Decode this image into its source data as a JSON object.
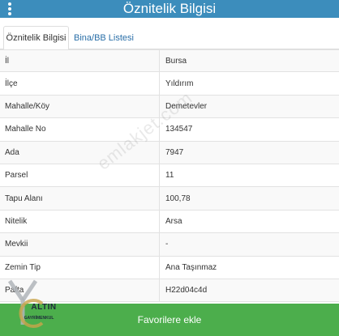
{
  "header": {
    "title": "Öznitelik Bilgisi"
  },
  "tabs": [
    {
      "label": "Öznitelik Bilgisi",
      "active": true
    },
    {
      "label": "Bina/BB Listesi",
      "active": false
    }
  ],
  "rows": [
    {
      "label": "İl",
      "value": "Bursa"
    },
    {
      "label": "İlçe",
      "value": "Yıldırım"
    },
    {
      "label": "Mahalle/Köy",
      "value": "Demetevler"
    },
    {
      "label": "Mahalle No",
      "value": "134547"
    },
    {
      "label": "Ada",
      "value": "7947"
    },
    {
      "label": "Parsel",
      "value": "11"
    },
    {
      "label": "Tapu Alanı",
      "value": "100,78"
    },
    {
      "label": "Nitelik",
      "value": "Arsa"
    },
    {
      "label": "Mevkii",
      "value": "-"
    },
    {
      "label": "Zemin Tip",
      "value": "Ana Taşınmaz"
    },
    {
      "label": "Pafta",
      "value": "H22d04c4d"
    }
  ],
  "favorite_button": {
    "label": "Favorilere ekle"
  },
  "watermark": {
    "text": "emlakjet.com"
  },
  "logo": {
    "name": "ALTIN",
    "subtitle": "GAYRİMENKUL"
  },
  "colors": {
    "header": "#3c8dbc",
    "button": "#4cae4c",
    "link": "#2a6fa8"
  },
  "icons": {
    "menu": "vertical-dots-icon"
  }
}
